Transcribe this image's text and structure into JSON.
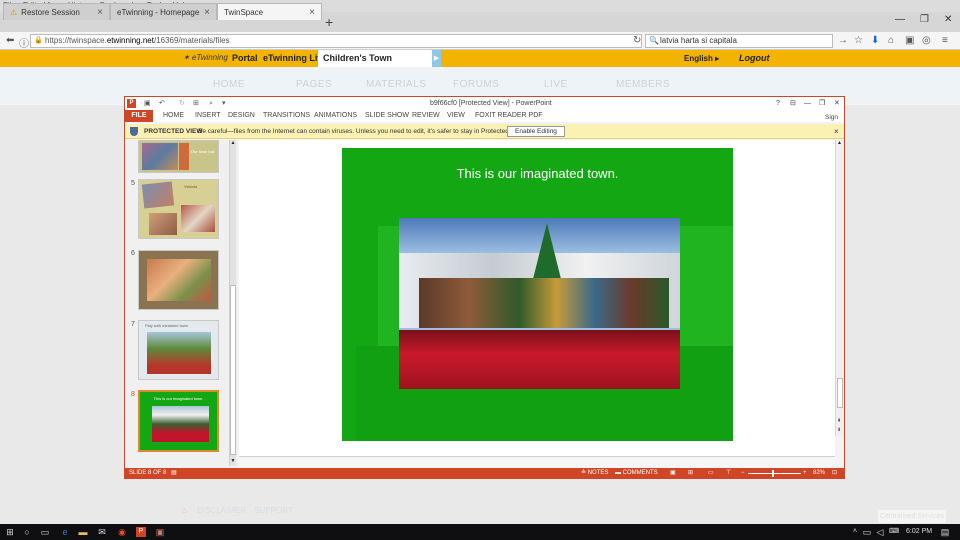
{
  "browser": {
    "menu": [
      "File",
      "Edit",
      "View",
      "History",
      "Bookmarks",
      "Tools",
      "Help"
    ],
    "tabs": [
      {
        "label": "Restore Session"
      },
      {
        "label": "eTwinning - Homepage"
      },
      {
        "label": "TwinSpace"
      }
    ],
    "url_prefix": "https://twinspace.",
    "url_domain": "etwinning.net",
    "url_rest": "/16369/materials/files",
    "search_value": "latvia harta si capitala"
  },
  "site": {
    "logo_text": "eTwinning",
    "portal_label": "Portal",
    "live_label": "eTwinning Live",
    "project_title": "Children's Town",
    "language": "English",
    "logout_label": "Logout",
    "nav": [
      "HOME",
      "PAGES",
      "MATERIALS",
      "FORUMS",
      "LIVE",
      "MEMBERS"
    ],
    "footer_links": [
      "DISCLAIMER",
      "SUPPORT"
    ],
    "faded_corner": "Centralised Services"
  },
  "ppt": {
    "title": "b9f66cf0 [Protected View] - PowerPoint",
    "sign_in": "Sign in",
    "ribbon_tabs": [
      "FILE",
      "HOME",
      "INSERT",
      "DESIGN",
      "TRANSITIONS",
      "ANIMATIONS",
      "SLIDE SHOW",
      "REVIEW",
      "VIEW",
      "FOXIT READER PDF"
    ],
    "protected_label": "PROTECTED VIEW",
    "protected_msg": "Be careful—files from the Internet can contain viruses. Unless you need to edit, it's safer to stay in Protected View.",
    "enable_editing": "Enable Editing",
    "thumbnails": [
      {
        "num": "5",
        "caption": "Victoria"
      },
      {
        "num": "6",
        "caption": ""
      },
      {
        "num": "7",
        "caption": "Play with miniature town"
      },
      {
        "num": "8",
        "caption": "This is our imaginated town."
      }
    ],
    "thumb4_caption": "Our town hall",
    "slide_title": "This is our imaginated town.",
    "status_slide": "SLIDE 8 OF 8",
    "notes_label": "NOTES",
    "comments_label": "COMMENTS",
    "zoom": "82%"
  },
  "taskbar": {
    "time": "6:02 PM"
  },
  "colors": {
    "accent_orange": "#f3b400",
    "ppt_red": "#d04525",
    "slide_green": "#13a813"
  }
}
